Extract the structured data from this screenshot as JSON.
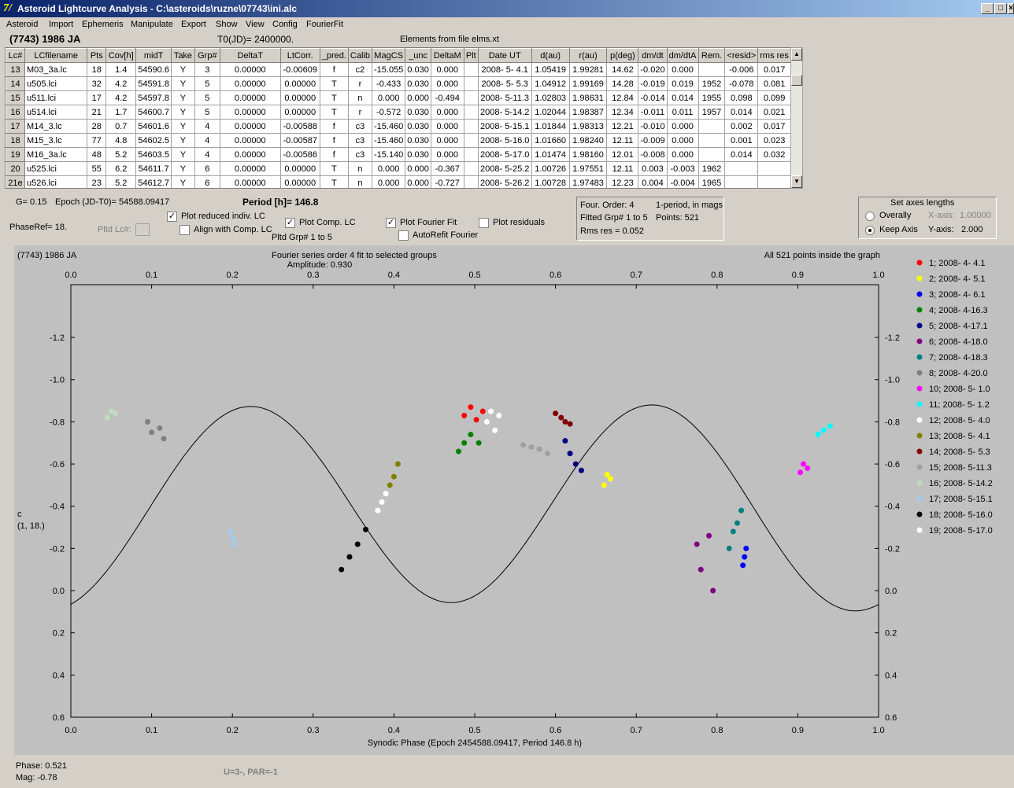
{
  "window": {
    "title": "Asteroid Lightcurve Analysis - C:\\asteroids\\ruzne\\07743\\ini.alc",
    "min": "_",
    "max": "□",
    "close": "×"
  },
  "menu": [
    "Asteroid",
    "Import",
    "Ephemeris",
    "Manipulate",
    "Export",
    "Show",
    "View",
    "Config",
    "FourierFit"
  ],
  "header": {
    "asteroid": "(7743) 1986 JA",
    "t0": "T0(JD)= 2400000.",
    "elements": "Elements from file elms.xt"
  },
  "table": {
    "columns": [
      "Lc#",
      "LCfilename",
      "Pts",
      "Cov[h]",
      "midT",
      "Take",
      "Grp#",
      "DeltaT",
      "LtCorr.",
      "_pred.",
      "Calib",
      "MagCS",
      "_unc",
      "DeltaM",
      "Plt",
      "Date UT",
      "d(au)",
      "r(au)",
      "p(deg)",
      "dm/dt",
      "dm/dtA",
      "Rem.",
      "<resid>",
      "rms res"
    ],
    "rows": [
      [
        "13",
        "M03_3a.lc",
        "18",
        "1.4",
        "54590.6",
        "Y",
        "3",
        "0.00000",
        "-0.00609",
        "f",
        "c2",
        "-15.055",
        "0.030",
        "0.000",
        "",
        "2008- 5- 4.1",
        "1.05419",
        "1.99281",
        "14.62",
        "-0.020",
        "0.000",
        "",
        "-0.006",
        "0.017"
      ],
      [
        "14",
        "u505.lci",
        "32",
        "4.2",
        "54591.8",
        "Y",
        "5",
        "0.00000",
        "0.00000",
        "T",
        "r",
        "-0.433",
        "0.030",
        "0.000",
        "",
        "2008- 5- 5.3",
        "1.04912",
        "1.99169",
        "14.28",
        "-0.019",
        "0.019",
        "1952",
        "-0.078",
        "0.081"
      ],
      [
        "15",
        "u511.lci",
        "17",
        "4.2",
        "54597.8",
        "Y",
        "5",
        "0.00000",
        "0.00000",
        "T",
        "n",
        "0.000",
        "0.000",
        "-0.494",
        "",
        "2008- 5-11.3",
        "1.02803",
        "1.98631",
        "12.84",
        "-0.014",
        "0.014",
        "1955",
        "0.098",
        "0.099"
      ],
      [
        "16",
        "u514.lci",
        "21",
        "1.7",
        "54600.7",
        "Y",
        "5",
        "0.00000",
        "0.00000",
        "T",
        "r",
        "-0.572",
        "0.030",
        "0.000",
        "",
        "2008- 5-14.2",
        "1.02044",
        "1.98387",
        "12.34",
        "-0.011",
        "0.011",
        "1957",
        "0.014",
        "0.021"
      ],
      [
        "17",
        "M14_3.lc",
        "28",
        "0.7",
        "54601.6",
        "Y",
        "4",
        "0.00000",
        "-0.00588",
        "f",
        "c3",
        "-15.460",
        "0.030",
        "0.000",
        "",
        "2008- 5-15.1",
        "1.01844",
        "1.98313",
        "12.21",
        "-0.010",
        "0.000",
        "",
        "0.002",
        "0.017"
      ],
      [
        "18",
        "M15_3.lc",
        "77",
        "4.8",
        "54602.5",
        "Y",
        "4",
        "0.00000",
        "-0.00587",
        "f",
        "c3",
        "-15.460",
        "0.030",
        "0.000",
        "",
        "2008- 5-16.0",
        "1.01660",
        "1.98240",
        "12.11",
        "-0.009",
        "0.000",
        "",
        "0.001",
        "0.023"
      ],
      [
        "19",
        "M16_3a.lc",
        "48",
        "5.2",
        "54603.5",
        "Y",
        "4",
        "0.00000",
        "-0.00586",
        "f",
        "c3",
        "-15.140",
        "0.030",
        "0.000",
        "",
        "2008- 5-17.0",
        "1.01474",
        "1.98160",
        "12.01",
        "-0.008",
        "0.000",
        "",
        "0.014",
        "0.032"
      ],
      [
        "20",
        "u525.lci",
        "55",
        "6.2",
        "54611.7",
        "Y",
        "6",
        "0.00000",
        "0.00000",
        "T",
        "n",
        "0.000",
        "0.000",
        "-0.367",
        "",
        "2008- 5-25.2",
        "1.00726",
        "1.97551",
        "12.11",
        "0.003",
        "-0.003",
        "1962",
        "",
        ""
      ],
      [
        "21e",
        "u526.lci",
        "23",
        "5.2",
        "54612.7",
        "Y",
        "6",
        "0.00000",
        "0.00000",
        "T",
        "n",
        "0.000",
        "0.000",
        "-0.727",
        "",
        "2008- 5-26.2",
        "1.00728",
        "1.97483",
        "12.23",
        "0.004",
        "-0.004",
        "1965",
        "",
        ""
      ]
    ]
  },
  "controls": {
    "g": "G= 0.15",
    "epoch": "Epoch (JD-T0)= 54588.09417",
    "period": "Period [h]= 146.8",
    "phaseref": "PhaseRef= 18.",
    "pltd_lc": "Pltd Lc#:",
    "plot_reduced": "Plot reduced indiv. LC",
    "align": "Align with Comp. LC",
    "plot_comp": "Plot Comp. LC",
    "pltd_grp": "Pltd Grp#  1   to   5",
    "plot_fourier": "Plot Fourier Fit",
    "autorefit": "AutoRefit Fourier",
    "plot_resid": "Plot residuals",
    "checked": {
      "plot_reduced": true,
      "align": false,
      "plot_comp": true,
      "plot_fourier": true,
      "autorefit": false,
      "plot_resid": false
    }
  },
  "fourier_info": {
    "order": "Four. Order:  4",
    "mode": "1-period, in mags",
    "fitted": "Fitted Grp# 1 to 5",
    "points": "Points: 521",
    "rms": "Rms res      = 0.052"
  },
  "axes_panel": {
    "title": "Set axes lengths",
    "overally": "Overally",
    "keep": "Keep Axis",
    "xlabel": "X-axis:",
    "xval": "1.00000",
    "ylabel": "Y-axis:",
    "yval": "2.000"
  },
  "status": {
    "phase": "Phase:  0.521",
    "mag": "Mag:    -0.78",
    "u": "U=3-, PAR=-1"
  },
  "chart_data": {
    "type": "scatter",
    "title": "Fourier series order 4 fit to selected groups",
    "subtitle": "Amplitude: 0.930",
    "top_left": "(7743) 1986 JA",
    "top_right": "All 521 points inside the graph",
    "xlabel": "Synodic Phase (Epoch 2454588.09417, Period 146.8 h)",
    "ylabel": "c",
    "ylabel2": "(1, 18.)",
    "xlim": [
      0,
      1
    ],
    "ylim": [
      -1.45,
      0.6
    ],
    "xticks": [
      "0.0",
      "0.1",
      "0.2",
      "0.3",
      "0.4",
      "0.5",
      "0.6",
      "0.7",
      "0.8",
      "0.9",
      "1.0"
    ],
    "yticks": [
      "-1.2",
      "-1.0",
      "-0.8",
      "-0.6",
      "-0.4",
      "-0.2",
      "0.0",
      "0.2",
      "0.4",
      "0.6"
    ],
    "fit": {
      "mean": -0.4,
      "a1": 0.02,
      "b1": 0.0,
      "a2": 0.445,
      "b2": -0.17
    },
    "series": [
      {
        "name": "1; 2008- 4- 4.1",
        "color": "#ff0000",
        "x": [
          0.487,
          0.495,
          0.502,
          0.51
        ],
        "y": [
          -0.83,
          -0.87,
          -0.81,
          -0.85
        ]
      },
      {
        "name": "2; 2008- 4- 5.1",
        "color": "#ffff00",
        "x": [
          0.66,
          0.664,
          0.668
        ],
        "y": [
          -0.5,
          -0.55,
          -0.53
        ]
      },
      {
        "name": "3; 2008- 4- 6.1",
        "color": "#0000ff",
        "x": [
          0.832,
          0.834,
          0.836
        ],
        "y": [
          -0.12,
          -0.16,
          -0.2
        ]
      },
      {
        "name": "4; 2008- 4-16.3",
        "color": "#008000",
        "x": [
          0.48,
          0.487,
          0.495,
          0.505
        ],
        "y": [
          -0.66,
          -0.7,
          -0.74,
          -0.7
        ]
      },
      {
        "name": "5; 2008- 4-17.1",
        "color": "#000080",
        "x": [
          0.612,
          0.618,
          0.625,
          0.632
        ],
        "y": [
          -0.71,
          -0.65,
          -0.6,
          -0.57
        ]
      },
      {
        "name": "6; 2008- 4-18.0",
        "color": "#800080",
        "x": [
          0.775,
          0.78,
          0.79,
          0.795
        ],
        "y": [
          -0.22,
          -0.1,
          -0.26,
          0.0
        ]
      },
      {
        "name": "7; 2008- 4-18.3",
        "color": "#008080",
        "x": [
          0.815,
          0.82,
          0.825,
          0.83
        ],
        "y": [
          -0.2,
          -0.28,
          -0.32,
          -0.38
        ]
      },
      {
        "name": "8; 2008- 4-20.0",
        "color": "#808080",
        "x": [
          0.095,
          0.1,
          0.11,
          0.115
        ],
        "y": [
          -0.8,
          -0.75,
          -0.77,
          -0.72
        ]
      },
      {
        "name": "10; 2008- 5- 1.0",
        "color": "#ff00ff",
        "x": [
          0.903,
          0.907,
          0.912
        ],
        "y": [
          -0.56,
          -0.6,
          -0.58
        ]
      },
      {
        "name": "11; 2008- 5- 1.2",
        "color": "#00ffff",
        "x": [
          0.925,
          0.932,
          0.94
        ],
        "y": [
          -0.74,
          -0.76,
          -0.78
        ]
      },
      {
        "name": "12; 2008- 5- 4.0",
        "color": "#ffffff",
        "x": [
          0.515,
          0.52,
          0.525,
          0.53
        ],
        "y": [
          -0.8,
          -0.85,
          -0.76,
          -0.83
        ]
      },
      {
        "name": "13; 2008- 5- 4.1",
        "color": "#808000",
        "x": [
          0.395,
          0.4,
          0.405
        ],
        "y": [
          -0.5,
          -0.54,
          -0.6
        ]
      },
      {
        "name": "14; 2008- 5- 5.3",
        "color": "#800000",
        "x": [
          0.6,
          0.607,
          0.612,
          0.618
        ],
        "y": [
          -0.84,
          -0.82,
          -0.8,
          -0.79
        ]
      },
      {
        "name": "15; 2008- 5-11.3",
        "color": "#a0a0a0",
        "x": [
          0.56,
          0.57,
          0.58,
          0.59
        ],
        "y": [
          -0.69,
          -0.68,
          -0.67,
          -0.65
        ]
      },
      {
        "name": "16; 2008- 5-14.2",
        "color": "#c0dcc0",
        "x": [
          0.045,
          0.05,
          0.055
        ],
        "y": [
          -0.82,
          -0.85,
          -0.84
        ]
      },
      {
        "name": "17; 2008- 5-15.1",
        "color": "#a6caf0",
        "x": [
          0.198,
          0.2,
          0.202
        ],
        "y": [
          -0.28,
          -0.25,
          -0.22
        ]
      },
      {
        "name": "18; 2008- 5-16.0",
        "color": "#000000",
        "x": [
          0.335,
          0.345,
          0.355,
          0.365
        ],
        "y": [
          -0.1,
          -0.16,
          -0.22,
          -0.29
        ]
      },
      {
        "name": "19; 2008- 5-17.0",
        "color": "#ffffff",
        "x": [
          0.38,
          0.385,
          0.39
        ],
        "y": [
          -0.38,
          -0.42,
          -0.46
        ]
      }
    ]
  }
}
